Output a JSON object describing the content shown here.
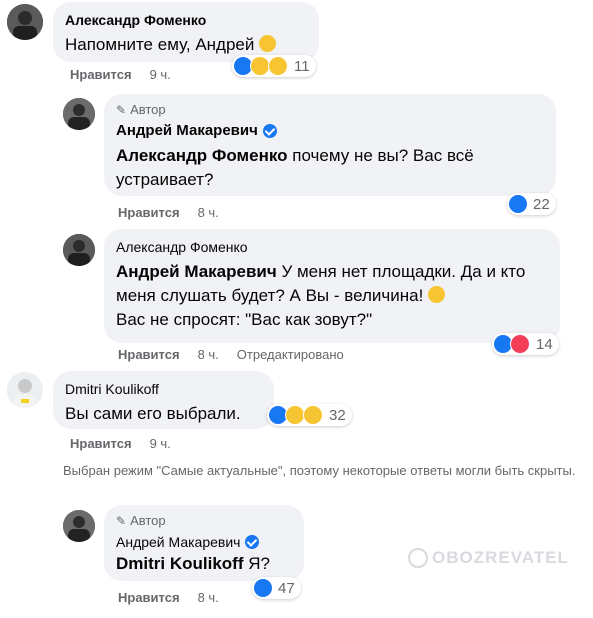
{
  "comments": [
    {
      "author": "Александр Фоменко",
      "text": "Напомните ему, Андрей",
      "reaction_count": "11",
      "like": "Нравится",
      "time": "9 ч."
    },
    {
      "author_tag": "Автор",
      "author": "Андрей Макаревич",
      "mention": "Александр Фоменко",
      "text": " почему не вы? Вас всё устраивает?",
      "reaction_count": "22",
      "like": "Нравится",
      "time": "8 ч."
    },
    {
      "author": "Александр Фоменко",
      "mention": "Андрей Макаревич",
      "text": " У меня нет площадки. Да и кто меня слушать будет? А Вы - величина!",
      "text_after": "Вас не спросят: \"Вас как зовут?\"",
      "reaction_count": "14",
      "like": "Нравится",
      "time": "8 ч.",
      "edited": "Отредактировано"
    },
    {
      "author": "Dmitri Koulikoff",
      "text": "Вы сами его выбрали.",
      "reaction_count": "32",
      "like": "Нравится",
      "time": "9 ч."
    },
    {
      "author_tag": "Автор",
      "author": "Андрей Макаревич",
      "mention": "Dmitri Koulikoff",
      "text": " Я?",
      "reaction_count": "47",
      "like": "Нравится",
      "time": "8 ч."
    }
  ],
  "notice": "Выбран режим \"Самые актуальные\", поэтому некоторые ответы могли быть скрыты.",
  "watermark": "OBOZREVATEL",
  "colors": {
    "accent": "#1877f2",
    "bubble": "#f0f2f5",
    "secondary_text": "#65676b"
  }
}
